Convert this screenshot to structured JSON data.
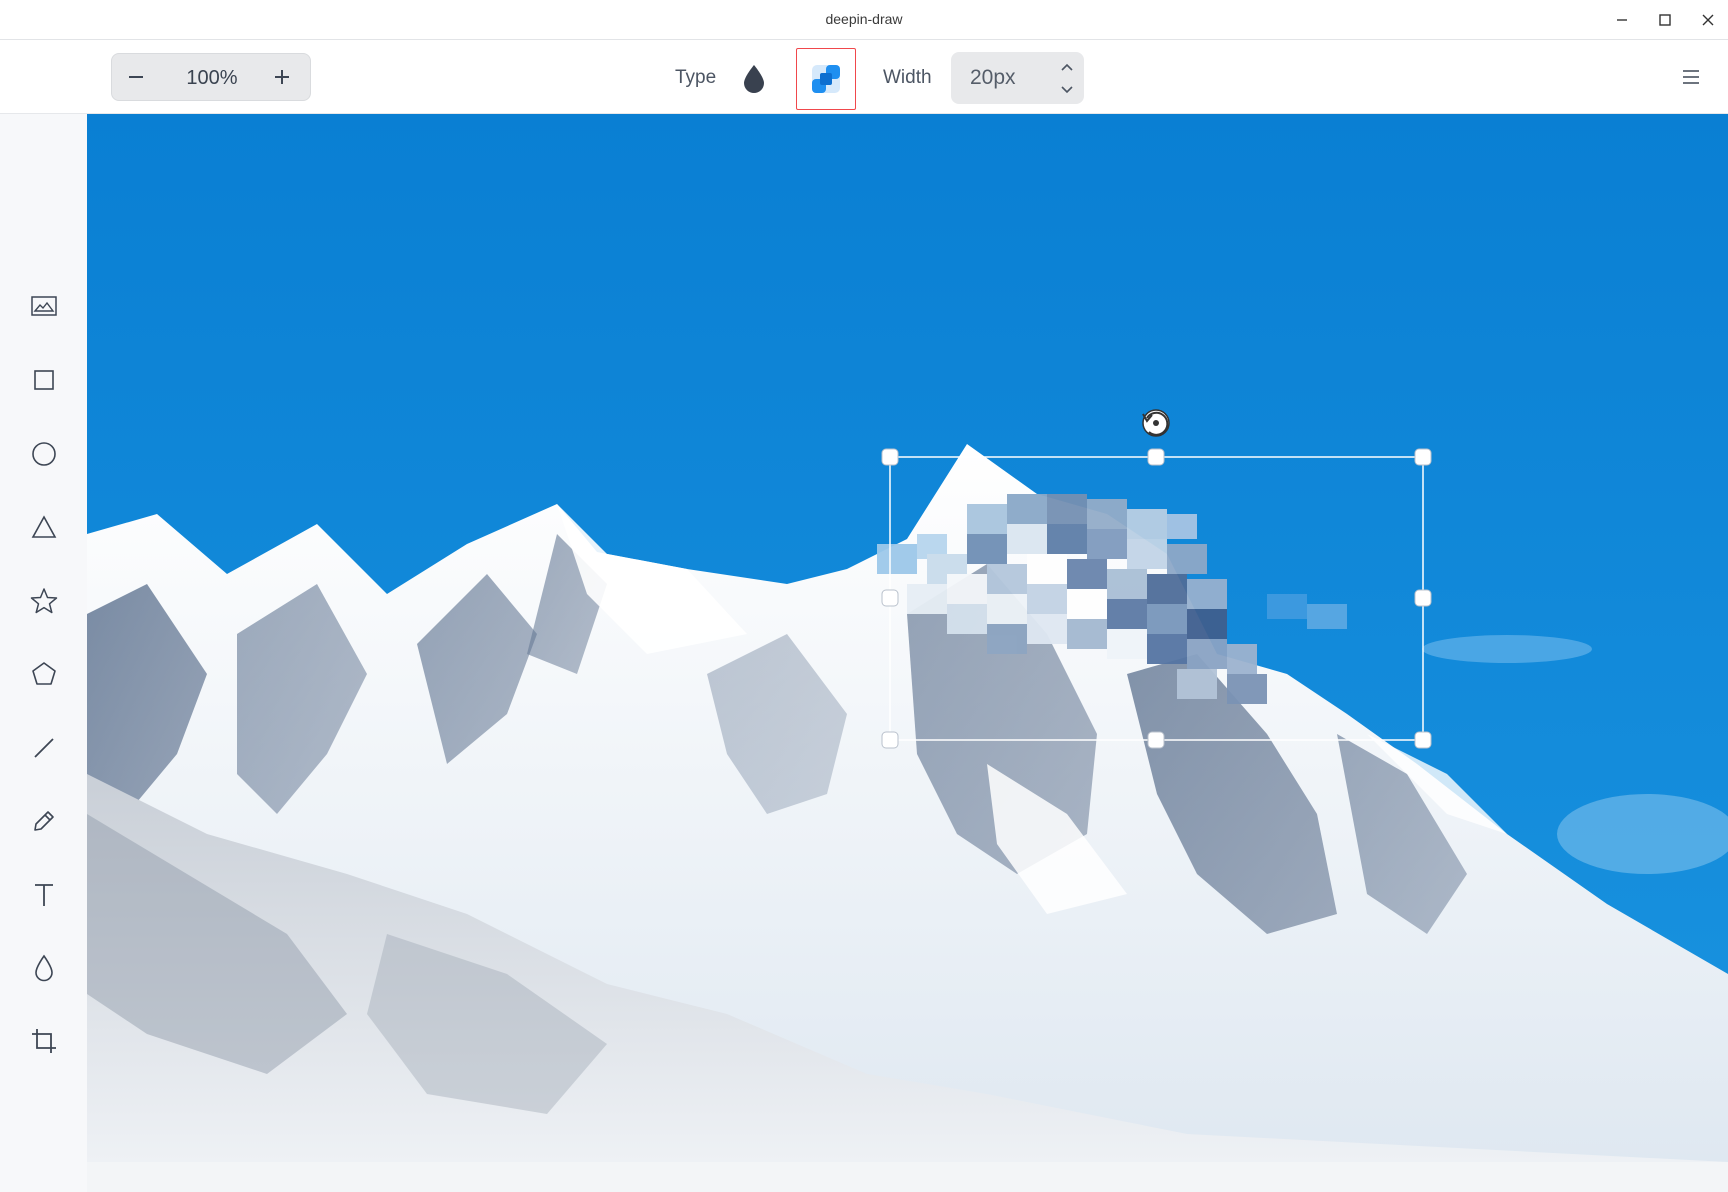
{
  "window": {
    "title": "deepin-draw"
  },
  "toolbar": {
    "zoom_value": "100%",
    "type_label": "Type",
    "width_label": "Width",
    "width_value": "20px"
  },
  "sidebar": {
    "tools": [
      {
        "name": "image-icon"
      },
      {
        "name": "rectangle-icon"
      },
      {
        "name": "ellipse-icon"
      },
      {
        "name": "triangle-icon"
      },
      {
        "name": "star-icon"
      },
      {
        "name": "polygon-icon"
      },
      {
        "name": "line-icon"
      },
      {
        "name": "pencil-icon"
      },
      {
        "name": "text-icon"
      },
      {
        "name": "blur-icon"
      },
      {
        "name": "crop-icon"
      }
    ]
  },
  "colors": {
    "sky": "#0d8ad9",
    "selection_handle": "#ffffff",
    "active_outline": "#f0484c",
    "mosaic_accent": "#1f8ff0"
  }
}
